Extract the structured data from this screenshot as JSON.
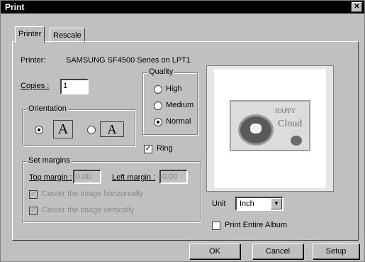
{
  "window": {
    "title": "Print",
    "close_symbol": "✕"
  },
  "tabs": [
    {
      "label": "Printer"
    },
    {
      "label": "Rescale"
    }
  ],
  "printer": {
    "label": "Printer:",
    "name": "SAMSUNG SF4500 Series on LPT1"
  },
  "copies": {
    "label": "Copies :",
    "value": "1"
  },
  "quality": {
    "legend": "Quality",
    "options": [
      "High",
      "Medium",
      "Normal"
    ],
    "selected": "Normal"
  },
  "orientation": {
    "legend": "Orientation",
    "portrait_glyph": "A",
    "landscape_glyph": "A",
    "selected": "portrait"
  },
  "ring": {
    "label": "Ring",
    "checked": true
  },
  "margins": {
    "legend": "Set margins",
    "top_label": "Top margin :",
    "top_value": "0.00",
    "left_label": "Left margin :",
    "left_value": "0.00",
    "center_h_label": "Center the image horizontally",
    "center_v_label": "Center the image vertically"
  },
  "preview": {
    "headline_small": "HAPPY",
    "headline_large": "Cloud"
  },
  "unit": {
    "label": "Unit",
    "value": "Inch"
  },
  "entire_album": {
    "label": "Print Entire Album",
    "checked": false
  },
  "buttons": {
    "ok": "OK",
    "cancel": "Cancel",
    "setup": "Setup"
  }
}
